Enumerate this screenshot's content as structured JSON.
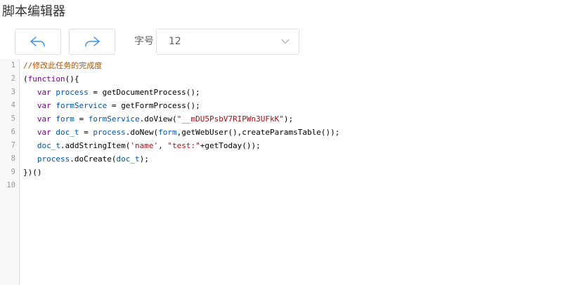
{
  "title": "脚本编辑器",
  "toolbar": {
    "undo_icon": "undo-icon",
    "redo_icon": "redo-icon",
    "font_size_label": "字号",
    "font_size_value": "12",
    "accent_color": "#3a8ee6"
  },
  "editor": {
    "line_numbers": [
      "1",
      "2",
      "3",
      "4",
      "5",
      "6",
      "7",
      "8",
      "9",
      "10"
    ],
    "lines": [
      [
        {
          "t": "//修改此任务的完成度",
          "c": "com"
        }
      ],
      [
        {
          "t": "(",
          "c": "def"
        },
        {
          "t": "function",
          "c": "kw"
        },
        {
          "t": "(){",
          "c": "def"
        }
      ],
      [
        {
          "t": "   ",
          "c": "def"
        },
        {
          "t": "var",
          "c": "kw"
        },
        {
          "t": " ",
          "c": "def"
        },
        {
          "t": "process",
          "c": "var"
        },
        {
          "t": " = getDocumentProcess();",
          "c": "def"
        }
      ],
      [
        {
          "t": "   ",
          "c": "def"
        },
        {
          "t": "var",
          "c": "kw"
        },
        {
          "t": " ",
          "c": "def"
        },
        {
          "t": "formService",
          "c": "var"
        },
        {
          "t": " = getFormProcess();",
          "c": "def"
        }
      ],
      [
        {
          "t": "   ",
          "c": "def"
        },
        {
          "t": "var",
          "c": "kw"
        },
        {
          "t": " ",
          "c": "def"
        },
        {
          "t": "form",
          "c": "var"
        },
        {
          "t": " = ",
          "c": "def"
        },
        {
          "t": "formService",
          "c": "var"
        },
        {
          "t": ".doView(",
          "c": "def"
        },
        {
          "t": "\"__mDU5PsbV7RIPWn3UFkK\"",
          "c": "str"
        },
        {
          "t": ");",
          "c": "def"
        }
      ],
      [
        {
          "t": "   ",
          "c": "def"
        },
        {
          "t": "var",
          "c": "kw"
        },
        {
          "t": " ",
          "c": "def"
        },
        {
          "t": "doc_t",
          "c": "var"
        },
        {
          "t": " = ",
          "c": "def"
        },
        {
          "t": "process",
          "c": "var"
        },
        {
          "t": ".doNew(",
          "c": "def"
        },
        {
          "t": "form",
          "c": "var"
        },
        {
          "t": ",getWebUser(),createParamsTable());",
          "c": "def"
        }
      ],
      [
        {
          "t": "   ",
          "c": "def"
        },
        {
          "t": "doc_t",
          "c": "var"
        },
        {
          "t": ".addStringItem(",
          "c": "def"
        },
        {
          "t": "'name'",
          "c": "str"
        },
        {
          "t": ", ",
          "c": "def"
        },
        {
          "t": "\"test:\"",
          "c": "str"
        },
        {
          "t": "+getToday());",
          "c": "def"
        }
      ],
      [
        {
          "t": "   ",
          "c": "def"
        },
        {
          "t": "process",
          "c": "var"
        },
        {
          "t": ".doCreate(",
          "c": "def"
        },
        {
          "t": "doc_t",
          "c": "var"
        },
        {
          "t": ");",
          "c": "def"
        }
      ],
      [
        {
          "t": "})()",
          "c": "def"
        }
      ],
      [
        {
          "t": "",
          "c": "def"
        }
      ]
    ]
  }
}
